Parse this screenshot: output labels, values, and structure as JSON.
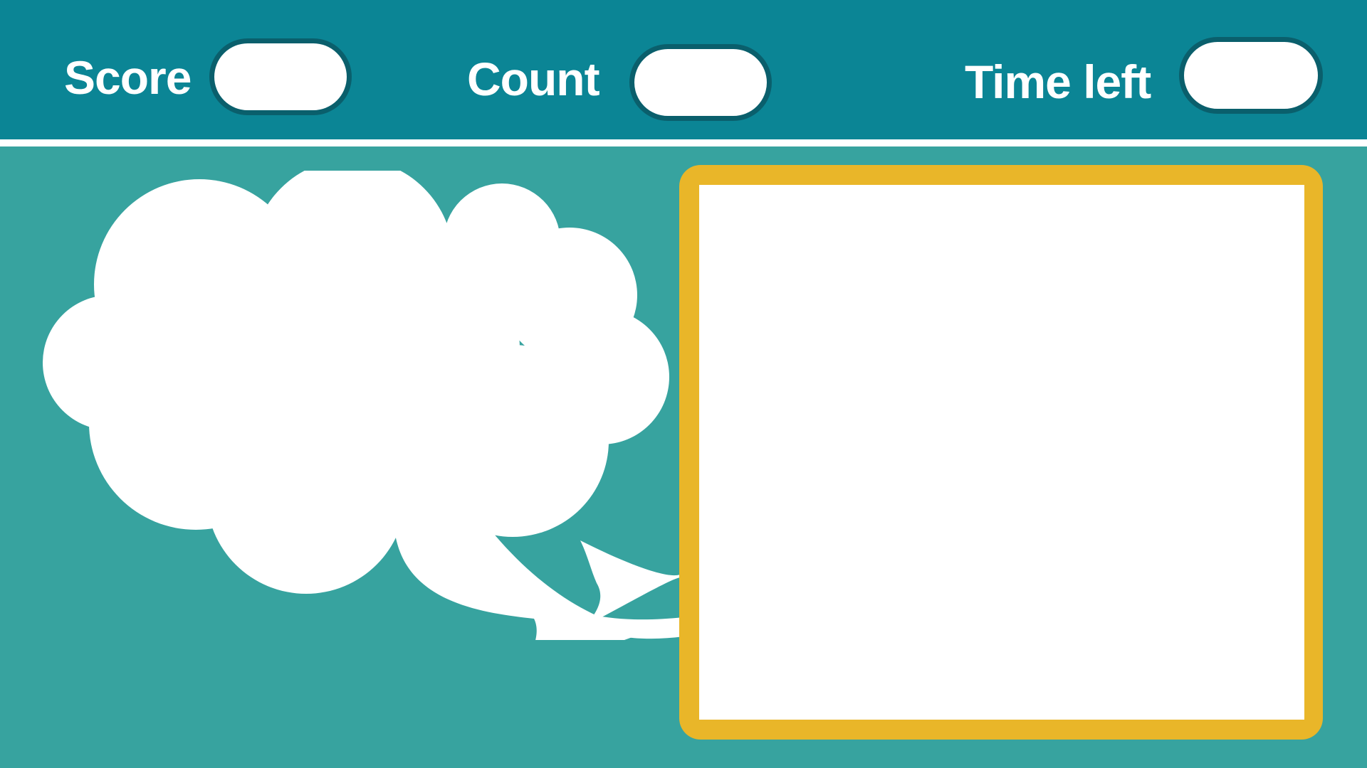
{
  "hud": {
    "score_label": "Score",
    "score_value": "",
    "count_label": "Count",
    "count_value": "",
    "time_label": "Time left",
    "time_value": ""
  },
  "colors": {
    "header_bg": "#0b8595",
    "page_bg": "#37a39f",
    "field_border": "#0a5f6c",
    "frame_border": "#e9b629"
  },
  "icons": {
    "thought_cloud": "thought-bubble-icon",
    "arrow": "curved-arrow-icon"
  }
}
